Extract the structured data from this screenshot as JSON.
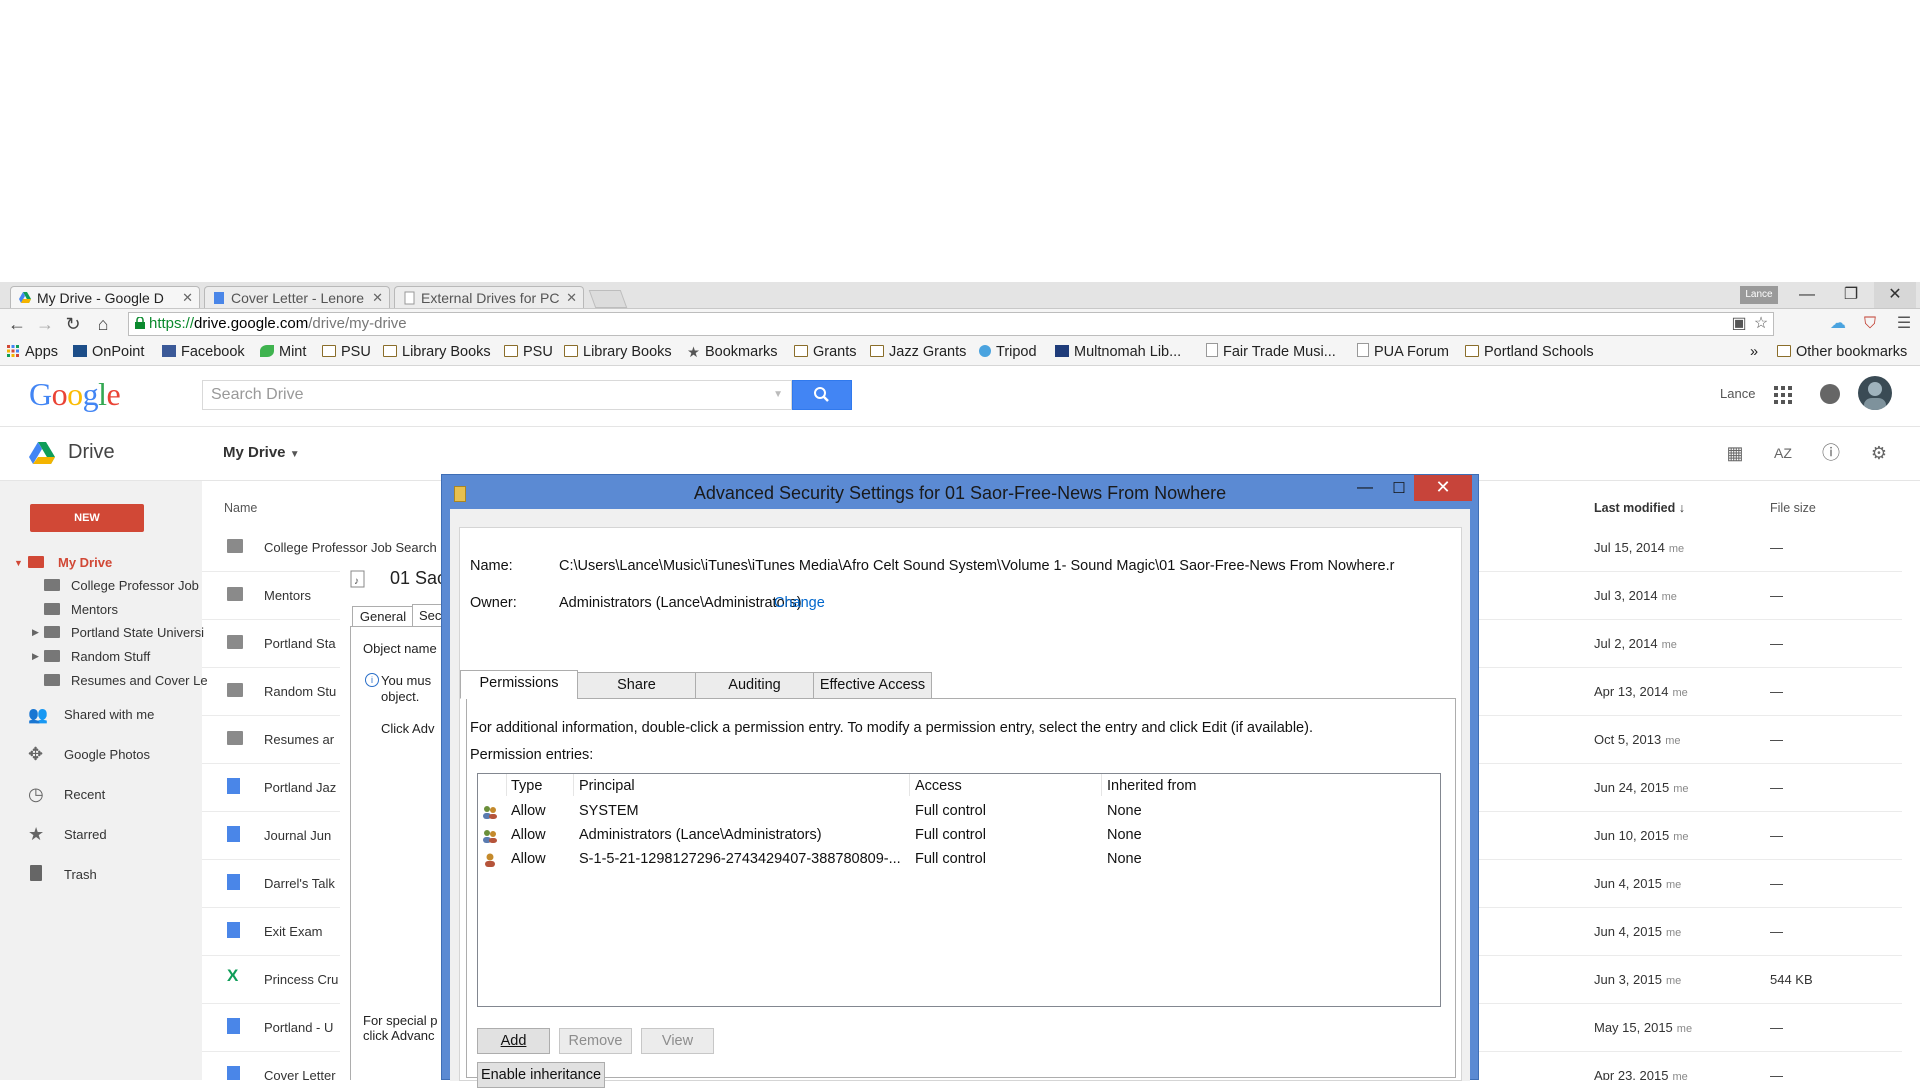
{
  "browser": {
    "tabs": [
      {
        "title": "My Drive - Google D",
        "active": true
      },
      {
        "title": "Cover Letter - Lenore",
        "active": false
      },
      {
        "title": "External Drives for PC",
        "active": false
      }
    ],
    "profile": "Lance",
    "url": {
      "scheme": "https://",
      "host": "drive.google.com",
      "path": "/drive/my-drive"
    },
    "bookmarks": [
      "Apps",
      "OnPoint",
      "Facebook",
      "Mint",
      "PSU",
      "Library Books",
      "PSU",
      "Library Books",
      "Bookmarks",
      "Grants",
      "Jazz Grants",
      "Tripod",
      "Multnomah  Lib...",
      "Fair Trade Musi...",
      "PUA Forum",
      "Portland Schools"
    ],
    "bookmarks_overflow": "»",
    "other_bookmarks": "Other bookmarks"
  },
  "drive": {
    "logo": "Google",
    "search_placeholder": "Search Drive",
    "user": "Lance",
    "app_title": "Drive",
    "breadcrumb": "My Drive",
    "new_button": "NEW",
    "sidebar": {
      "my_drive": "My Drive",
      "tree": [
        "College Professor Job",
        "Mentors",
        "Portland State Universi",
        "Random Stuff",
        "Resumes and Cover Le"
      ],
      "nav": [
        "Shared with me",
        "Google Photos",
        "Recent",
        "Starred",
        "Trash"
      ]
    },
    "columns": {
      "name": "Name",
      "modified": "Last modified",
      "size": "File size"
    },
    "files": [
      {
        "name": "College Professor Job Search",
        "type": "folder",
        "date": "Jul 15, 2014",
        "owner": "me",
        "size": "—"
      },
      {
        "name": "Mentors",
        "type": "folder",
        "date": "Jul 3, 2014",
        "owner": "me",
        "size": "—"
      },
      {
        "name": "Portland Sta",
        "type": "folder",
        "date": "Jul 2, 2014",
        "owner": "me",
        "size": "—"
      },
      {
        "name": "Random Stu",
        "type": "folder",
        "date": "Apr 13, 2014",
        "owner": "me",
        "size": "—"
      },
      {
        "name": "Resumes ar",
        "type": "folder",
        "date": "Oct 5, 2013",
        "owner": "me",
        "size": "—"
      },
      {
        "name": "Portland Jaz",
        "type": "doc",
        "date": "Jun 24, 2015",
        "owner": "me",
        "size": "—"
      },
      {
        "name": "Journal Jun",
        "type": "doc",
        "date": "Jun 10, 2015",
        "owner": "me",
        "size": "—"
      },
      {
        "name": "Darrel's Talk",
        "type": "doc",
        "date": "Jun 4, 2015",
        "owner": "me",
        "size": "—"
      },
      {
        "name": "Exit Exam",
        "type": "doc",
        "date": "Jun 4, 2015",
        "owner": "me",
        "size": "—"
      },
      {
        "name": "Princess Cru",
        "type": "sheet",
        "date": "Jun 3, 2015",
        "owner": "me",
        "size": "544 KB"
      },
      {
        "name": "Portland - U",
        "type": "doc",
        "date": "May 15, 2015",
        "owner": "me",
        "size": "—"
      },
      {
        "name": "Cover Letter",
        "type": "doc",
        "date": "Apr 23, 2015",
        "owner": "me",
        "size": "—"
      }
    ]
  },
  "props_dialog": {
    "title": "01 Sao",
    "tabs": [
      "General",
      "Sec"
    ],
    "object_name": "Object name",
    "notice_1": "You mus",
    "notice_2": "object.",
    "click_adv": "Click Adv",
    "special_1": "For special p",
    "special_2": "click Advanc"
  },
  "security_dialog": {
    "title": "Advanced Security Settings for 01 Saor-Free-News From Nowhere",
    "name_label": "Name:",
    "name_value": "C:\\Users\\Lance\\Music\\iTunes\\iTunes Media\\Afro Celt Sound System\\Volume 1- Sound Magic\\01 Saor-Free-News From Nowhere.r",
    "owner_label": "Owner:",
    "owner_value": "Administrators (Lance\\Administrators)",
    "change_link": "Change",
    "tabs": [
      "Permissions",
      "Share",
      "Auditing",
      "Effective Access"
    ],
    "info_text": "For additional information, double-click a permission entry. To modify a permission entry, select the entry and click Edit (if available).",
    "entries_label": "Permission entries:",
    "columns": [
      "Type",
      "Principal",
      "Access",
      "Inherited from"
    ],
    "entries": [
      {
        "type": "Allow",
        "principal": "SYSTEM",
        "access": "Full control",
        "inherited": "None"
      },
      {
        "type": "Allow",
        "principal": "Administrators (Lance\\Administrators)",
        "access": "Full control",
        "inherited": "None"
      },
      {
        "type": "Allow",
        "principal": "S-1-5-21-1298127296-2743429407-388780809-...",
        "access": "Full control",
        "inherited": "None"
      }
    ],
    "buttons": {
      "add": "Add",
      "remove": "Remove",
      "view": "View",
      "enable_inheritance": "Enable inheritance"
    }
  }
}
